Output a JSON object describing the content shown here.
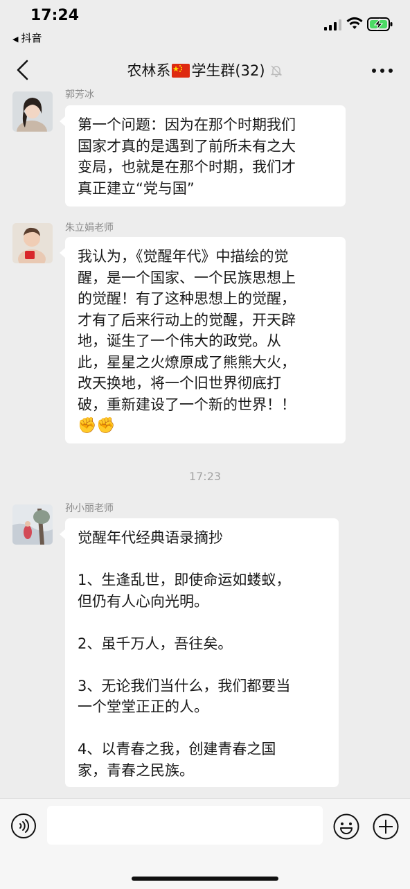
{
  "status_bar": {
    "time": "17:24",
    "back_app": "抖音"
  },
  "nav": {
    "title_prefix": "农林系",
    "title_suffix": "学生群(32)",
    "flag_icon": "china-flag-icon",
    "mute_icon": "bell-muted-icon",
    "more_icon": "more-dots-icon",
    "back_icon": "chevron-left-icon"
  },
  "messages": [
    {
      "sender": "郭芳冰",
      "lines": [
        "第一个问题：因为在那个时期我们",
        "国家才真的是遇到了前所未有之大",
        "变局，也就是在那个时期，我们才",
        "真正建立“党与国”"
      ]
    },
    {
      "sender": "朱立娟老师",
      "lines": [
        "我认为，《觉醒年代》中描绘的觉",
        "醒，是一个国家、一个民族思想上",
        "的觉醒！有了这种思想上的觉醒，",
        "才有了后来行动上的觉醒，开天辟",
        "地，诞生了一个伟大的政党。从",
        "此，星星之火燎原成了熊熊大火，",
        "改天换地，将一个旧世界彻底打",
        "破，重新建设了一个新的世界！！"
      ],
      "emoji": "✊✊"
    },
    {
      "sender": "孙小丽老师",
      "lines": [
        "觉醒年代经典语录摘抄",
        "",
        "1、生逢乱世，即使命运如蝼蚁，",
        "但仍有人心向光明。",
        "",
        "2、虽千万人，吾往矣。",
        "",
        "3、无论我们当什么，我们都要当",
        "一个堂堂正正的人。",
        "",
        "4、以青春之我，创建青春之国",
        "家，青春之民族。"
      ]
    }
  ],
  "timestamp": "17:23",
  "input_bar": {
    "voice_icon": "voice-icon",
    "emoji_icon": "emoji-icon",
    "plus_icon": "plus-icon",
    "input_value": ""
  },
  "colors": {
    "background": "#ededed",
    "bubble": "#ffffff",
    "text": "#191919",
    "muted": "#8a8a8a"
  }
}
